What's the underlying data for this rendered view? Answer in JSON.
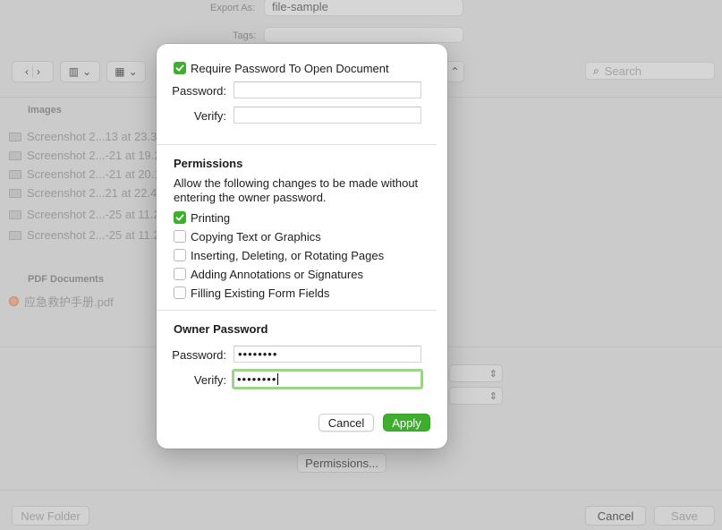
{
  "background": {
    "export_as_label": "Export As:",
    "export_as_value": "file-sample",
    "tags_label": "Tags:",
    "search_placeholder": "Search",
    "sidebar_images_header": "Images",
    "images": [
      "Screenshot 2...13 at 23.3",
      "Screenshot 2...-21 at 19.2",
      "Screenshot 2...-21 at 20.1",
      "Screenshot 2...21 at 22.4",
      "Screenshot 2...-25 at 11.2",
      "Screenshot 2...-25 at 11.2"
    ],
    "sidebar_pdf_header": "PDF Documents",
    "pdf_file": "应急救护手册.pdf",
    "permissions_button": "Permissions...",
    "new_folder_button": "New Folder",
    "cancel_button": "Cancel",
    "save_button": "Save"
  },
  "sheet": {
    "require_password_label": "Require Password To Open Document",
    "require_password_checked": true,
    "password_label": "Password:",
    "verify_label": "Verify:",
    "password_value": "",
    "verify_value": "",
    "permissions_title": "Permissions",
    "permissions_description": "Allow the following changes to be made without entering the owner password.",
    "permissions": [
      {
        "label": "Printing",
        "checked": true
      },
      {
        "label": "Copying Text or Graphics",
        "checked": false
      },
      {
        "label": "Inserting, Deleting, or Rotating Pages",
        "checked": false
      },
      {
        "label": "Adding Annotations or Signatures",
        "checked": false
      },
      {
        "label": "Filling Existing Form Fields",
        "checked": false
      }
    ],
    "owner_title": "Owner Password",
    "owner_password_label": "Password:",
    "owner_verify_label": "Verify:",
    "owner_password_value": "••••••••",
    "owner_verify_value": "••••••••",
    "cancel_label": "Cancel",
    "apply_label": "Apply"
  },
  "colors": {
    "accent": "#3fae2e",
    "focus_ring": "#9dd389"
  }
}
